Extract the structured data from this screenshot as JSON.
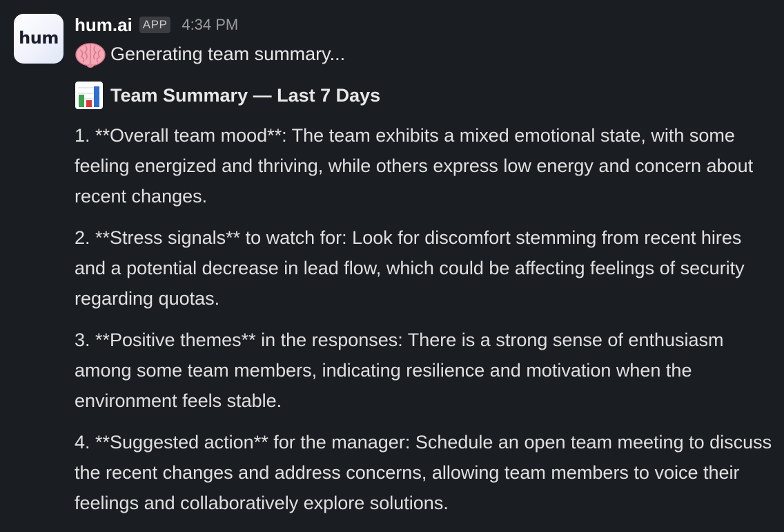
{
  "sender": {
    "name": "hum.ai",
    "badge": "APP",
    "timestamp": "4:34 PM",
    "avatar_text": "hum"
  },
  "status": {
    "icon": "brain-icon",
    "text": "Generating team summary..."
  },
  "summary": {
    "icon": "bar-chart-icon",
    "title": "Team Summary — Last 7 Days",
    "items": [
      "1. **Overall team mood**: The team exhibits a mixed emotional state, with some feeling energized and thriving, while others express low energy and concern about recent changes.",
      "2. **Stress signals** to watch for: Look for discomfort stemming from recent hires and a potential decrease in lead flow, which could be affecting feelings of security regarding quotas.",
      "3. **Positive themes** in the responses: There is a strong sense of enthusiasm among some team members, indicating resilience and motivation when the environment feels stable.",
      "4. **Suggested action** for the manager: Schedule an open team meeting to discuss the recent changes and address concerns, allowing team members to voice their feelings and collaboratively explore solutions."
    ]
  },
  "colors": {
    "background": "#1a1d21",
    "text": "#e0e0e0",
    "muted": "#9a9b9d",
    "badge_bg": "#3b3d42"
  }
}
